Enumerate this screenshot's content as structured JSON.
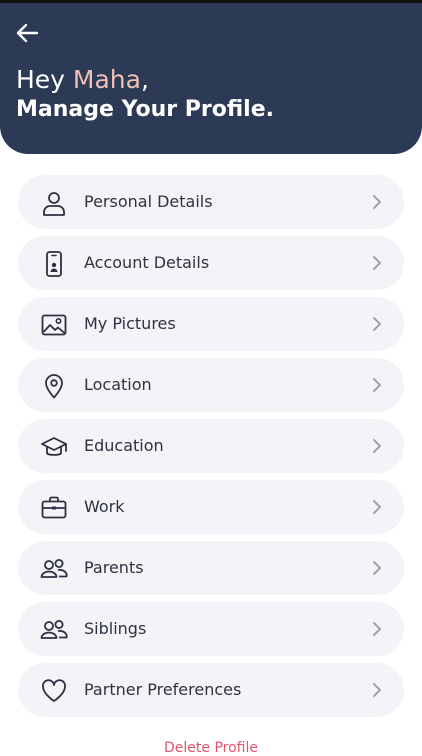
{
  "header": {
    "greeting_prefix": "Hey ",
    "user_name": "Maha",
    "greeting_suffix": ",",
    "subtitle": "Manage Your Profile.",
    "bg_color": "#2c3a55",
    "name_color": "#f0bfb7"
  },
  "menu": {
    "items": [
      {
        "label": "Personal Details",
        "icon": "user-icon"
      },
      {
        "label": "Account Details",
        "icon": "phone-id-icon"
      },
      {
        "label": "My Pictures",
        "icon": "image-icon"
      },
      {
        "label": "Location",
        "icon": "map-pin-icon"
      },
      {
        "label": "Education",
        "icon": "graduation-cap-icon"
      },
      {
        "label": "Work",
        "icon": "briefcase-icon"
      },
      {
        "label": "Parents",
        "icon": "users-icon"
      },
      {
        "label": "Siblings",
        "icon": "users-icon"
      },
      {
        "label": "Partner Preferences",
        "icon": "heart-icon"
      }
    ]
  },
  "footer": {
    "delete_label": "Delete Profile"
  }
}
